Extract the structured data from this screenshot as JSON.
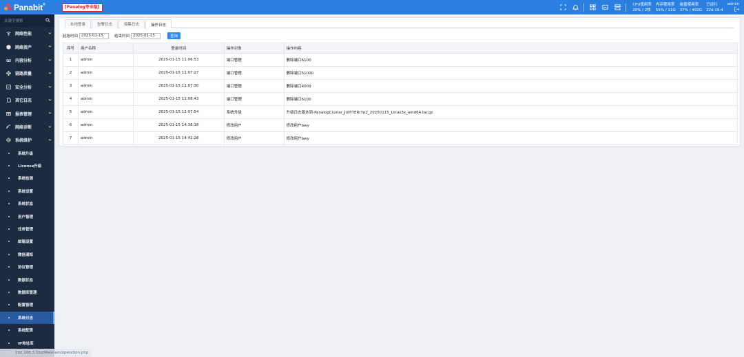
{
  "app": {
    "logo_text": "Panabit",
    "logo_mark": "®",
    "edition": "[Panalog专业版]"
  },
  "topbar": {
    "icons": [
      "fullscreen-icon",
      "bell-icon",
      "apps-icon",
      "message-icon",
      "server-icon"
    ],
    "stats": [
      {
        "label": "CPU使用率",
        "value": "20% / 2核"
      },
      {
        "label": "内存使用率",
        "value": "55% / 11G"
      },
      {
        "label": "磁盘使用率",
        "value": "37% / 492G"
      },
      {
        "label": "已运行",
        "value": "22d:19:4"
      }
    ],
    "user": "admin"
  },
  "sidebar": {
    "search_placeholder": "关键字搜索",
    "menu": [
      {
        "label": "网络性能",
        "icon": "wifi-icon"
      },
      {
        "label": "网络资产",
        "icon": "globe-icon"
      },
      {
        "label": "内容分析",
        "icon": "glasses-icon"
      },
      {
        "label": "链路质量",
        "icon": "link-icon"
      },
      {
        "label": "安全分析",
        "icon": "shield-icon"
      },
      {
        "label": "其它日志",
        "icon": "doc-icon"
      },
      {
        "label": "报表管理",
        "icon": "grid-icon"
      },
      {
        "label": "网络诊断",
        "icon": "signal-icon"
      },
      {
        "label": "系统维护",
        "icon": "gear-icon"
      }
    ],
    "submenu": [
      "系统升级",
      "License升级",
      "系统检测",
      "系统设置",
      "系统状态",
      "用户管理",
      "任务管理",
      "邮箱设置",
      "微信通知",
      "协议管理",
      "数据状态",
      "数据库管理",
      "配置管理",
      "系统日志",
      "系统配表",
      "IP地址库"
    ],
    "active_sub": "系统日志"
  },
  "statusbar": {
    "url": "192.168.3.162/Maintain/operation.php"
  },
  "main": {
    "tabs": [
      "本地登录",
      "告警日志",
      "接集日志",
      "操作日志"
    ],
    "active_tab": "操作日志",
    "filters": {
      "start_label": "起始时间",
      "start_value": "2025-01-15",
      "end_label": "结束时间",
      "end_value": "2025-01-15",
      "query_button": "查询"
    },
    "table": {
      "columns": [
        "序号",
        "用户名称",
        "登录时间",
        "操作对象",
        "操作内容"
      ],
      "rows": [
        [
          "1",
          "admin",
          "2025-01-15 11:06:53",
          "端口管理",
          "删除端口6100"
        ],
        [
          "2",
          "admin",
          "2025-01-15 11:07:27",
          "端口管理",
          "删除端口51000"
        ],
        [
          "3",
          "admin",
          "2025-01-15 11:07:30",
          "端口管理",
          "删除端口4009"
        ],
        [
          "4",
          "admin",
          "2025-01-15 11:08:43",
          "端口管理",
          "删除端口6100"
        ],
        [
          "5",
          "admin",
          "2025-01-15 12:07:54",
          "系统升级",
          "升级日志版本到-PanalogCluster_JUPITERr7p2_20250115_Linux3x_amd64.tar.gz"
        ],
        [
          "6",
          "admin",
          "2025-01-15 14:38:18",
          "修改用户",
          "修改用户bwy"
        ],
        [
          "7",
          "admin",
          "2025-01-15 14:42:28",
          "修改用户",
          "修改用户bwy"
        ]
      ]
    }
  },
  "colors": {
    "topbar": "#2a7fe0",
    "sidebar": "#1c2b40",
    "active_item": "#2a5a9e",
    "query_button": "#2a8af2",
    "edition_red": "#e02020"
  }
}
